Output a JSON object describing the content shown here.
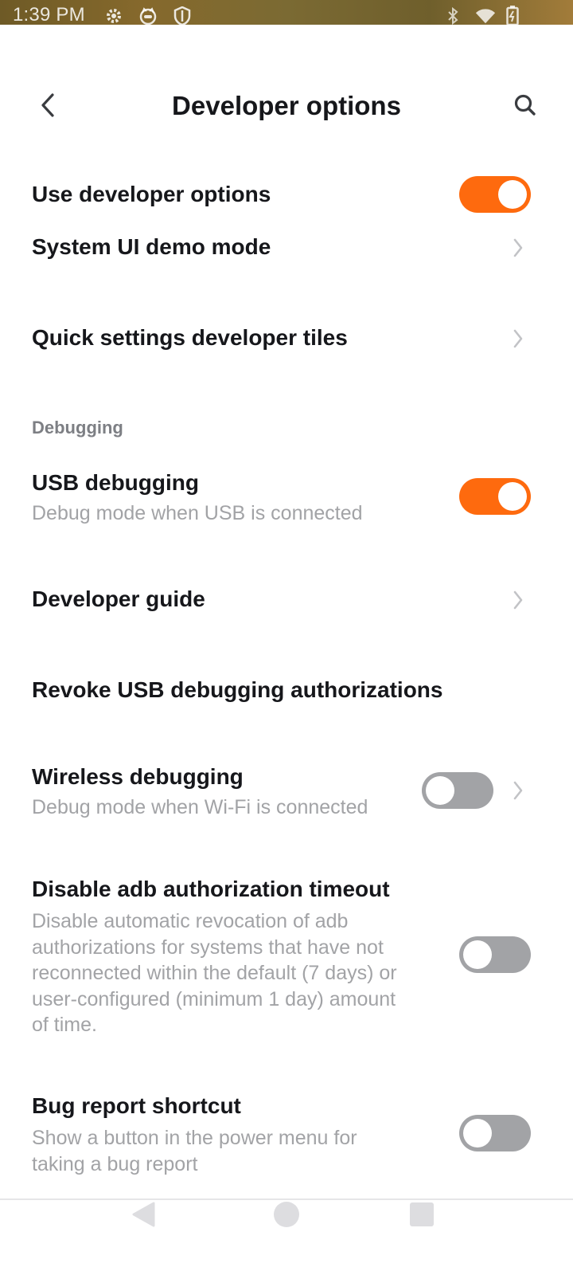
{
  "status_bar": {
    "time": "1:39 PM",
    "left_icons": [
      "gear-icon",
      "cat-face-icon",
      "shield-icon"
    ],
    "right_icons": [
      "bluetooth-icon",
      "wifi-icon",
      "battery-icon"
    ]
  },
  "header": {
    "title": "Developer options"
  },
  "items": {
    "use_dev": {
      "title": "Use developer options",
      "toggle_on": true
    },
    "demo_mode": {
      "title": "System UI demo mode"
    },
    "quick_tiles": {
      "title": "Quick settings developer tiles"
    },
    "section_debugging": "Debugging",
    "usb_debugging": {
      "title": "USB debugging",
      "subtitle": "Debug mode when USB is connected",
      "toggle_on": true
    },
    "dev_guide": {
      "title": "Developer guide"
    },
    "revoke_usb": {
      "title": "Revoke USB debugging authorizations"
    },
    "wireless": {
      "title": "Wireless debugging",
      "subtitle": "Debug mode when Wi-Fi is connected",
      "toggle_on": false
    },
    "adb_timeout": {
      "title": "Disable adb authorization timeout",
      "subtitle_lines": [
        "Disable automatic revocation of adb",
        "authorizations for systems that have not",
        "reconnected within the default (7 days) or",
        "user-configured (minimum 1 day) amount",
        "of time."
      ],
      "toggle_on": false
    },
    "bug_report": {
      "title": "Bug report shortcut",
      "subtitle_lines": [
        "Show a button in the power menu for",
        "taking a bug report"
      ],
      "toggle_on": false
    }
  },
  "colors": {
    "accent": "#fe6a0e",
    "toggle_off": "#a2a3a6",
    "text_primary": "#16171b",
    "text_secondary": "#a2a3a6",
    "section_label": "#7d7f84"
  },
  "nav_bar": {
    "icons": [
      "back-triangle-icon",
      "home-circle-icon",
      "recents-square-icon"
    ]
  }
}
